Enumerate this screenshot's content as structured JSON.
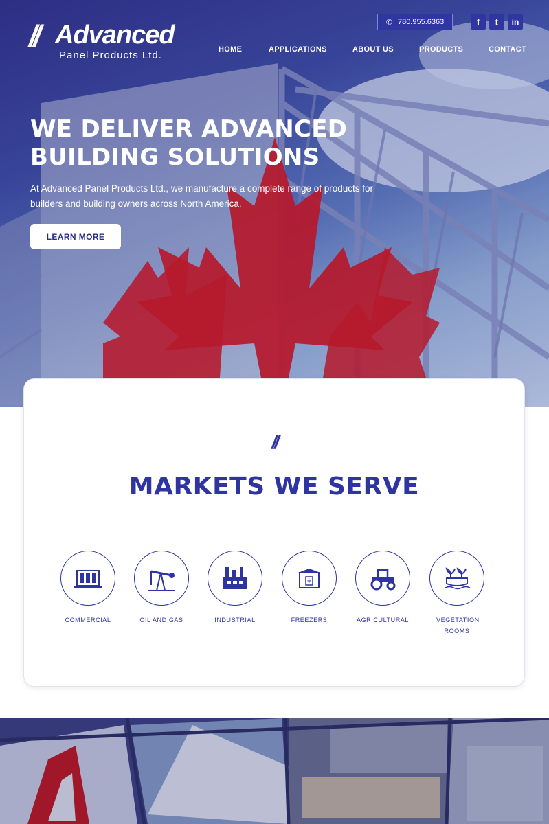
{
  "header": {
    "logo_slashes": "//",
    "logo_word": "Advanced",
    "logo_sub": "Panel Products Ltd.",
    "phone": "780.955.6363",
    "social": [
      "f",
      "t",
      "in"
    ],
    "nav": [
      "HOME",
      "APPLICATIONS",
      "ABOUT US",
      "PRODUCTS",
      "CONTACT"
    ]
  },
  "hero": {
    "headline_line1": "WE DELIVER ADVANCED",
    "headline_line2": "BUILDING SOLUTIONS",
    "lead": "At Advanced Panel Products Ltd., we manufacture a complete range of products for builders and building owners across North America.",
    "cta": "LEARN MORE"
  },
  "markets": {
    "slashes": "//",
    "title": "MARKETS WE SERVE",
    "items": [
      {
        "label": "COMMERCIAL",
        "icon": "commercial-building-icon"
      },
      {
        "label": "OIL AND GAS",
        "icon": "oil-pump-icon"
      },
      {
        "label": "INDUSTRIAL",
        "icon": "factory-icon"
      },
      {
        "label": "FREEZERS",
        "icon": "freezer-icon"
      },
      {
        "label": "AGRICULTURAL",
        "icon": "tractor-icon"
      },
      {
        "label": "VEGETATION ROOMS",
        "icon": "plant-icon"
      }
    ]
  },
  "colors": {
    "brand": "#2e34a0",
    "flag_red": "#d5151b"
  }
}
